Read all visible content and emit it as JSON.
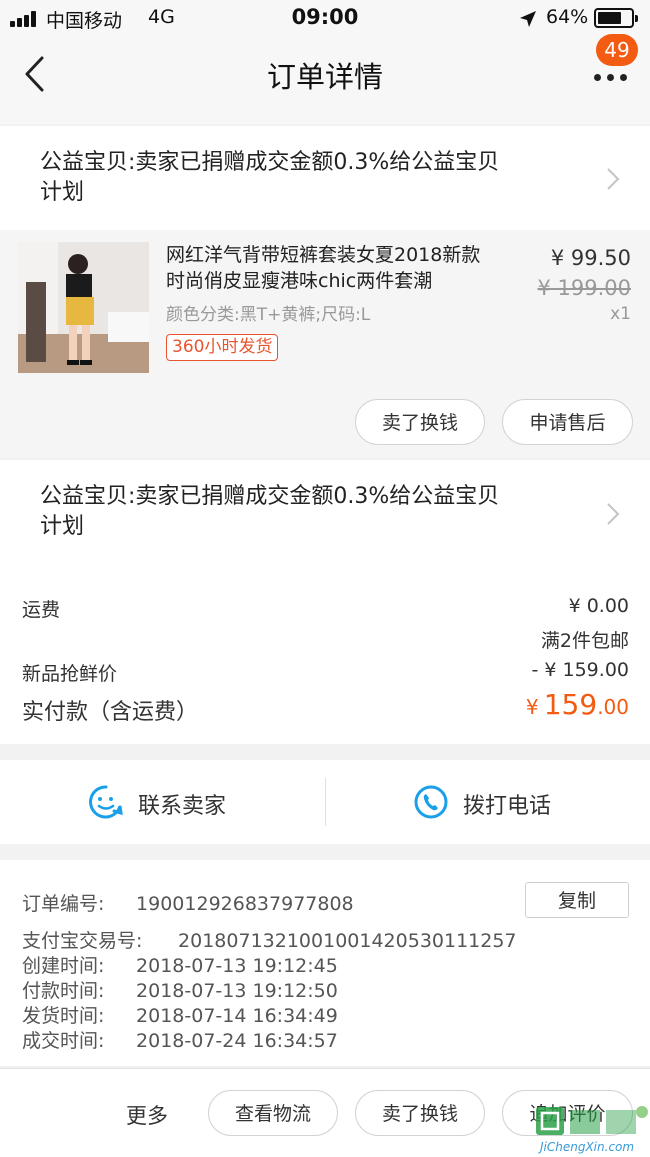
{
  "status_bar": {
    "carrier": "中国移动",
    "network": "4G",
    "time": "09:00",
    "battery": "64%",
    "battery_level": 0.64
  },
  "nav": {
    "title": "订单详情",
    "badge": "49",
    "icons": [
      "back-icon",
      "more-icon"
    ]
  },
  "charity_notice": {
    "text": "公益宝贝:卖家已捐赠成交金额0.3%给公益宝贝计划",
    "line1": "公益宝贝:卖家已捐赠成交金额0.3%给公益宝贝",
    "line2": "计划"
  },
  "product": {
    "title_line1": "网红洋气背带短裤套装女夏2018新款",
    "title_line2": "时尚俏皮显瘦港味chic两件套潮",
    "sku": "颜色分类:黑T+黄裤;尺码:L",
    "shipping_tag": "360小时发货",
    "price": "¥ 99.50",
    "original_price": "¥ 199.00",
    "quantity": "x1",
    "actions": [
      "卖了换钱",
      "申请售后"
    ]
  },
  "fees": {
    "shipping_label": "运费",
    "shipping_value": "¥ 0.00",
    "shipping_note": "满2件包邮",
    "discount_label": "新品抢鲜价",
    "discount_value": "- ¥ 159.00",
    "total_label": "实付款（含运费）",
    "total_currency": "¥",
    "total_int": "159",
    "total_dec": ".00"
  },
  "contact": {
    "seller": "联系卖家",
    "phone": "拨打电话",
    "colors": {
      "icon_blue": "#1aa0e8"
    }
  },
  "order_info": {
    "order_no_label": "订单编号:",
    "order_no": "190012926837977808",
    "copy": "复制",
    "alipay_label": "支付宝交易号:",
    "alipay_no": "2018071321001001420530111257",
    "created_label": "创建时间:",
    "created": "2018-07-13 19:12:45",
    "paid_label": "付款时间:",
    "paid": "2018-07-13 19:12:50",
    "shipped_label": "发货时间:",
    "shipped": "2018-07-14 16:34:49",
    "completed_label": "成交时间:",
    "completed": "2018-07-24 16:34:57"
  },
  "bottom_bar": {
    "more": "更多",
    "buttons": [
      "查看物流",
      "卖了换钱",
      "追加评价"
    ]
  },
  "watermark": {
    "brand": "JiChengXin.com"
  },
  "colors": {
    "accent": "#f35a12",
    "tag_red": "#e8542f"
  }
}
